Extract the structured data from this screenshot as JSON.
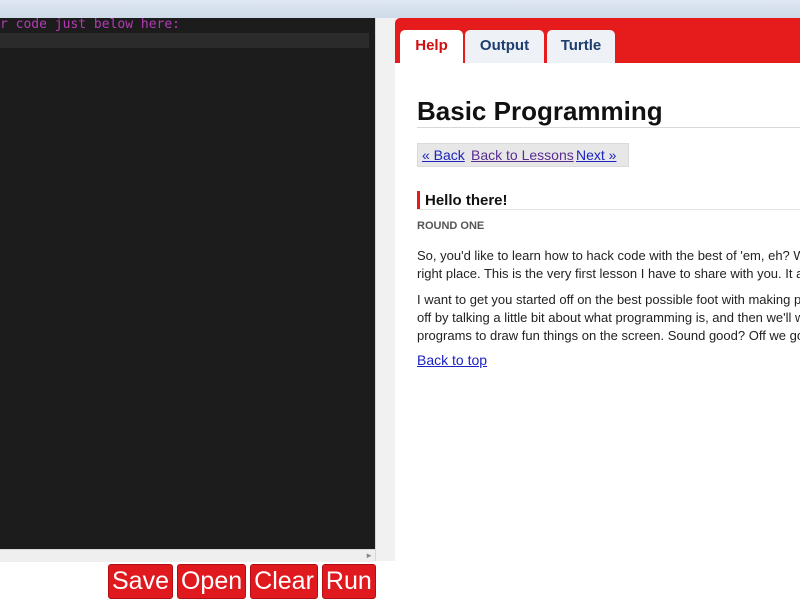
{
  "editor": {
    "code_line": "r code just below here:"
  },
  "buttons": {
    "save": "Save",
    "open": "Open",
    "clear": "Clear",
    "run": "Run"
  },
  "tabs": {
    "help": "Help",
    "output": "Output",
    "turtle": "Turtle"
  },
  "help": {
    "title": "Basic Programming",
    "nav": {
      "back": "« Back",
      "lessons": "Back to Lessons",
      "next": "Next »"
    },
    "section_title": "Hello there!",
    "round": "ROUND ONE",
    "p1_line1": "So, you'd like to learn how to hack code with the best of 'em, eh? We",
    "p1_line2": "right place. This is the very first lesson I have to share with you. It all s",
    "p2_line1": "I want to get you started off on the best possible foot with making pro",
    "p2_line2": "off by talking a little bit about what programming is, and then we'll wri",
    "p2_line3": "programs to draw fun things on the screen. Sound good? Off we go!",
    "back_to_top": "Back to top"
  },
  "colors": {
    "accent": "#e61b1b",
    "editor_bg": "#1c1c1c",
    "comment": "#b43ab4",
    "link": "#1c23c0"
  }
}
